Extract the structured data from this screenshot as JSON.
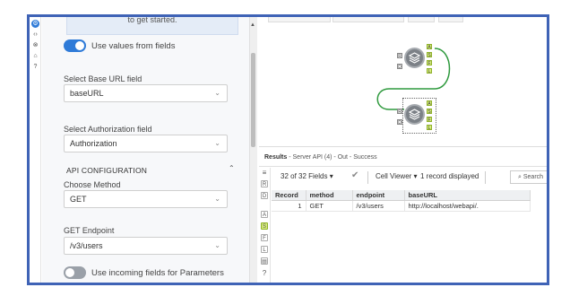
{
  "config": {
    "notice_text": "to get started.",
    "use_values_label": "Use values from fields",
    "base_url_label": "Select Base URL field",
    "base_url_value": "baseURL",
    "auth_label": "Select Authorization field",
    "auth_value": "Authorization",
    "api_section": "API CONFIGURATION",
    "method_label": "Choose Method",
    "method_value": "GET",
    "endpoint_label": "GET Endpoint",
    "endpoint_value": "/v3/users",
    "incoming_label": "Use incoming fields for Parameters"
  },
  "results": {
    "title_bold": "Results",
    "title_rest": " - Server API (4) - Out - Success",
    "fields_count": "32 of 32 Fields",
    "cell_viewer": "Cell Viewer",
    "records_displayed": "1 record displayed",
    "search_placeholder": "Search",
    "columns": [
      "Record",
      "method",
      "endpoint",
      "baseURL"
    ],
    "rows": [
      {
        "record": "1",
        "method": "GET",
        "endpoint": "/v3/users",
        "baseURL": "http://localhost/webapi/."
      }
    ]
  },
  "canvas": {
    "input_anchor_top": "R",
    "input_anchor_bottom": "D",
    "output_anchors": [
      "A",
      "S",
      "F",
      "L"
    ]
  },
  "colors": {
    "frame_border": "#3f63b6",
    "toggle_on": "#2f7bd8",
    "anchor_green": "#d7ee7a",
    "connector_green": "#2f9a3e"
  },
  "icons": {
    "collapse": "chevron-up-icon",
    "dropdown": "chevron-down-icon",
    "tool": "layers-icon"
  }
}
